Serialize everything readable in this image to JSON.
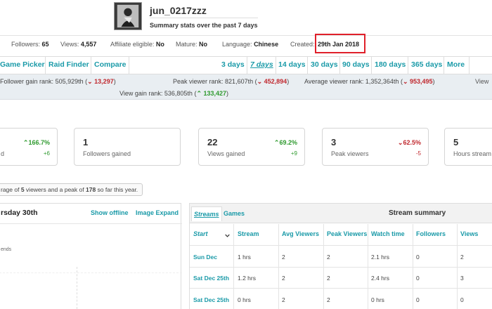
{
  "profile": {
    "username": "jun_0217zzz",
    "subtitle": "Summary stats over the past 7 days"
  },
  "meta": {
    "followers_label": "Followers:",
    "followers_value": "65",
    "views_label": "Views:",
    "views_value": "4,557",
    "affiliate_label": "Affiliate eligible:",
    "affiliate_value": "No",
    "mature_label": "Mature:",
    "mature_value": "No",
    "language_label": "Language:",
    "language_value": "Chinese",
    "created_label": "Created:",
    "created_value": "29th Jan 2018"
  },
  "nav": {
    "links": [
      "Game Picker",
      "Raid Finder",
      "Compare"
    ],
    "ranges": [
      "3 days",
      "7 days",
      "14 days",
      "30 days",
      "90 days",
      "180 days",
      "365 days",
      "More"
    ],
    "active_range": "7 days"
  },
  "ranks": {
    "follower_gain_label": "Follower gain rank:",
    "follower_gain_value": "505,929th",
    "follower_gain_change": "13,297",
    "peak_viewer_label": "Peak viewer rank:",
    "peak_viewer_value": "821,607th",
    "peak_viewer_change": "452,894",
    "avg_viewer_label": "Average viewer rank:",
    "avg_viewer_value": "1,352,364th",
    "avg_viewer_change": "953,495",
    "view_gain_label": "View gain rank:",
    "view_gain_value": "536,805th",
    "view_gain_change": "133,427"
  },
  "cards": [
    {
      "num": "",
      "label": "d",
      "pct": "166.7%",
      "delta": "+6",
      "trend": "up"
    },
    {
      "num": "1",
      "label": "Followers gained",
      "pct": "",
      "delta": "",
      "trend": "none"
    },
    {
      "num": "22",
      "label": "Views gained",
      "pct": "69.2%",
      "delta": "+9",
      "trend": "up"
    },
    {
      "num": "3",
      "label": "Peak viewers",
      "pct": "62.5%",
      "delta": "-5",
      "trend": "down"
    },
    {
      "num": "5",
      "label": "Hours stream",
      "pct": "",
      "delta": "",
      "trend": "none"
    }
  ],
  "note": {
    "prefix": "rage of ",
    "avg": "5",
    "mid": " viewers and a peak of ",
    "peak": "178",
    "suffix": " so far this year."
  },
  "left_panel": {
    "title": "rsday 30th",
    "show_offline": "Show offline",
    "image_expand": "Image Expand",
    "legend": "ends"
  },
  "table": {
    "tabs": [
      "Streams",
      "Games"
    ],
    "title": "Stream summary",
    "headers": [
      "Start",
      "Stream",
      "Avg Viewers",
      "Peak Viewers",
      "Watch time",
      "Followers",
      "Views"
    ],
    "rows": [
      [
        "Sun Dec",
        "1 hrs",
        "2",
        "2",
        "2.1 hrs",
        "0",
        "2"
      ],
      [
        "Sat Dec 25th",
        "1.2 hrs",
        "2",
        "2",
        "2.4 hrs",
        "0",
        "3"
      ],
      [
        "Sat Dec 25th",
        "0 hrs",
        "2",
        "2",
        "0 hrs",
        "0",
        "0"
      ]
    ]
  },
  "colors": {
    "accent": "#1a9aa8",
    "up": "#2f9a2f",
    "down": "#c0282e",
    "highlight_box": "#e0202a"
  }
}
